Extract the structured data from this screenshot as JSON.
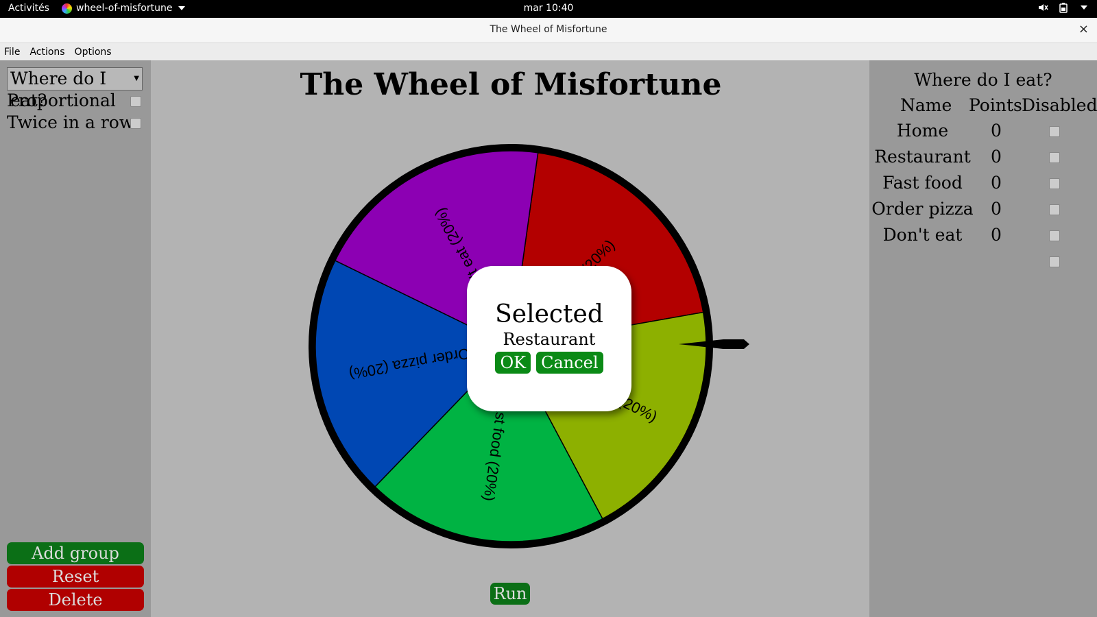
{
  "system_bar": {
    "activities": "Activités",
    "app_name": "wheel-of-misfortune",
    "clock": "mar 10:40"
  },
  "window": {
    "title": "The Wheel of Misfortune",
    "close": "×"
  },
  "menu": [
    "File",
    "Actions",
    "Options"
  ],
  "sidebar": {
    "group_select": "Where do I eat?",
    "options": [
      {
        "label": "Proportional",
        "checked": false
      },
      {
        "label": "Twice in a row",
        "checked": false
      }
    ],
    "buttons": {
      "add_group": "Add group",
      "reset": "Reset",
      "delete": "Delete"
    }
  },
  "main": {
    "title": "The Wheel of Misfortune",
    "run_label": "Run"
  },
  "wheel": {
    "segments": [
      {
        "label": "Home (20%)",
        "color": "#b30000"
      },
      {
        "label": "Restaurant (20%)",
        "color": "#8db000"
      },
      {
        "label": "Fast food (20%)",
        "color": "#00b343"
      },
      {
        "label": "Order pizza (20%)",
        "color": "#0047b3"
      },
      {
        "label": "Don't eat (20%)",
        "color": "#8c00b3"
      }
    ]
  },
  "dialog": {
    "heading": "Selected",
    "value": "Restaurant",
    "ok": "OK",
    "cancel": "Cancel"
  },
  "table": {
    "title": "Where do I eat?",
    "headers": {
      "name": "Name",
      "points": "Points",
      "disabled": "Disabled"
    },
    "rows": [
      {
        "name": "Home",
        "points": "0",
        "disabled": false
      },
      {
        "name": "Restaurant",
        "points": "0",
        "disabled": false
      },
      {
        "name": "Fast food",
        "points": "0",
        "disabled": false
      },
      {
        "name": "Order pizza",
        "points": "0",
        "disabled": false
      },
      {
        "name": "Don't eat",
        "points": "0",
        "disabled": false
      }
    ]
  },
  "colors": {
    "accent_green": "#0b6f16",
    "danger_red": "#b00000"
  }
}
